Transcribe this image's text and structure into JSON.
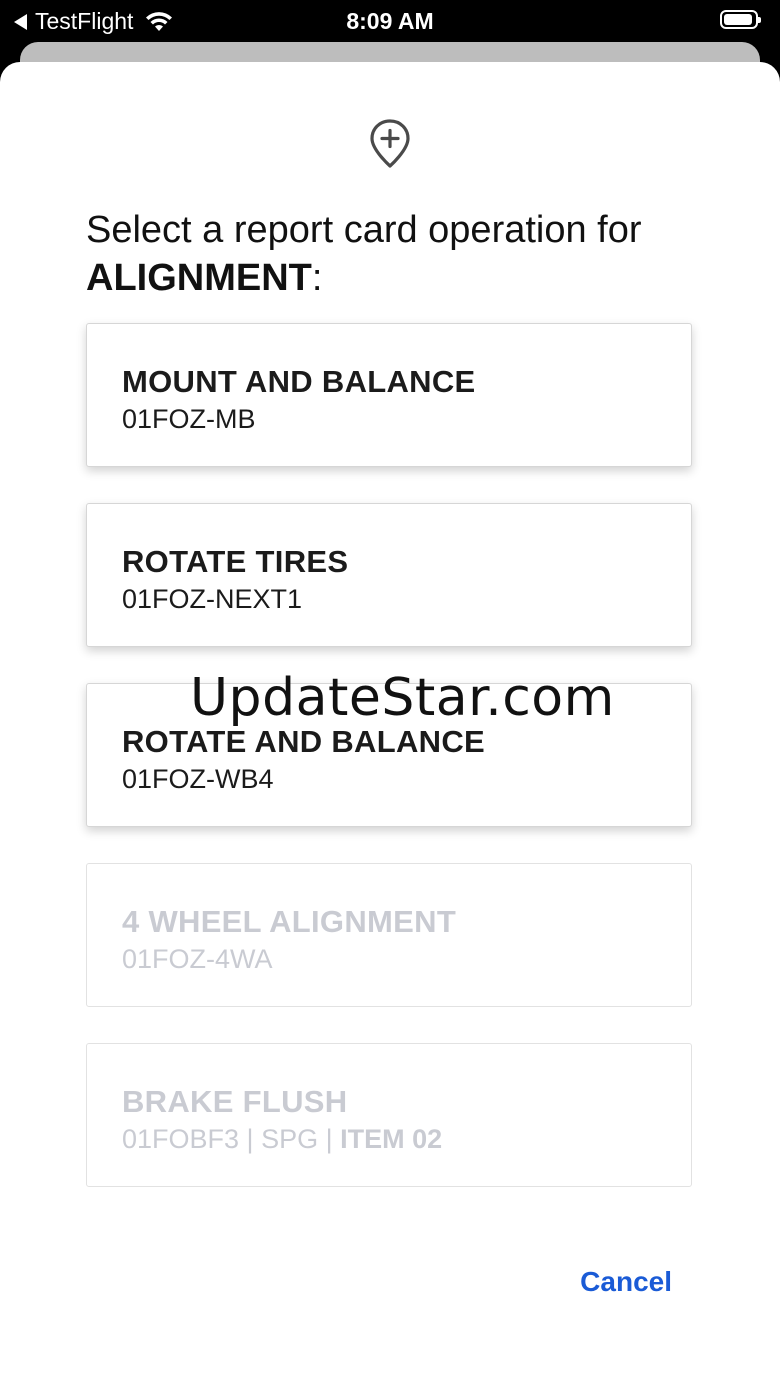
{
  "status_bar": {
    "back_app": "TestFlight",
    "time": "8:09 AM"
  },
  "dialog": {
    "icon": "location-pin-plus-icon",
    "prompt_text": "Select a report card operation for ",
    "prompt_subject": "ALIGNMENT",
    "prompt_suffix": ":",
    "operations": [
      {
        "name": "MOUNT AND BALANCE",
        "code": "01FOZ-MB",
        "enabled": true
      },
      {
        "name": "ROTATE TIRES",
        "code": "01FOZ-NEXT1",
        "enabled": true
      },
      {
        "name": "ROTATE AND BALANCE",
        "code": "01FOZ-WB4",
        "enabled": true
      },
      {
        "name": "4 WHEEL ALIGNMENT",
        "code": "01FOZ-4WA",
        "enabled": false
      },
      {
        "name": "BRAKE FLUSH",
        "code_parts": [
          "01FOBF3",
          " | SPG | ",
          "ITEM 02"
        ],
        "enabled": false
      }
    ],
    "cancel_label": "Cancel"
  },
  "watermark": "UpdateStar.com",
  "colors": {
    "accent": "#1a5bd6",
    "disabled_text": "#c9cbd2"
  }
}
